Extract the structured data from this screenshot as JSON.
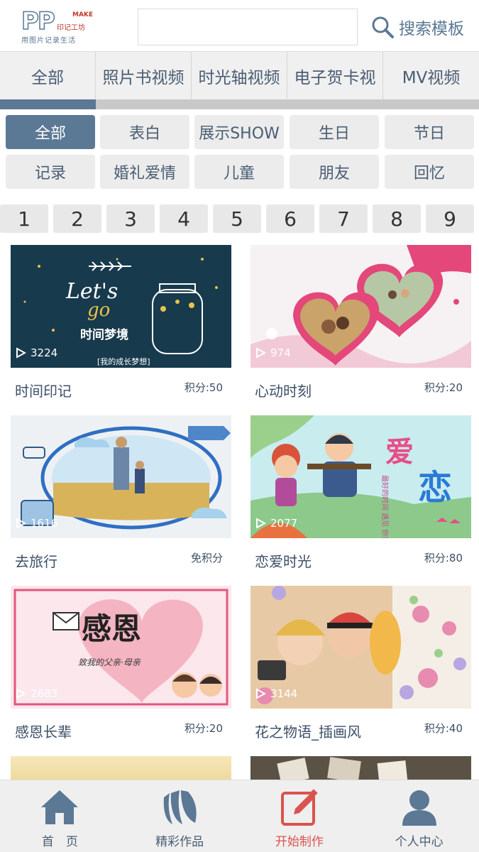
{
  "header": {
    "logo_text": "PP",
    "logo_make": "MAKE",
    "logo_brand": "印记工坊",
    "logo_slogan": "用图片记录生活",
    "search_value": "",
    "search_label": "搜索模板"
  },
  "category_tabs": [
    {
      "label": "全部",
      "active": true
    },
    {
      "label": "照片书视频"
    },
    {
      "label": "时光轴视频"
    },
    {
      "label": "电子贺卡视"
    },
    {
      "label": "MV视频"
    }
  ],
  "tags": [
    {
      "label": "全部",
      "active": true
    },
    {
      "label": "表白"
    },
    {
      "label": "展示SHOW"
    },
    {
      "label": "生日"
    },
    {
      "label": "节日"
    },
    {
      "label": "记录"
    },
    {
      "label": "婚礼爱情"
    },
    {
      "label": "儿童"
    },
    {
      "label": "朋友"
    },
    {
      "label": "回忆"
    }
  ],
  "pages": [
    "1",
    "2",
    "3",
    "4",
    "5",
    "6",
    "7",
    "8",
    "9"
  ],
  "templates": [
    {
      "title": "时间印记",
      "points": "积分:50",
      "views": "3224",
      "thumb_text": "时间梦境",
      "thumb_sub": "[我的成长梦想]",
      "thumb_lets": "Let's go"
    },
    {
      "title": "心动时刻",
      "points": "积分:20",
      "views": "974"
    },
    {
      "title": "去旅行",
      "points": "免积分",
      "views": "1616"
    },
    {
      "title": "恋爱时光",
      "points": "积分:80",
      "views": "2077",
      "thumb_big1": "爱",
      "thumb_big2": "恋",
      "thumb_small": "最好的时间 遇见 你我"
    },
    {
      "title": "感恩长辈",
      "points": "积分:20",
      "views": "2683",
      "thumb_text": "感恩",
      "thumb_sub": "致我的父亲·母亲"
    },
    {
      "title": "花之物语_插画风",
      "points": "积分:40",
      "views": "3144"
    }
  ],
  "bottom_nav": [
    {
      "label": "首　页",
      "icon": "home-icon"
    },
    {
      "label": "精彩作品",
      "icon": "works-icon"
    },
    {
      "label": "开始制作",
      "icon": "edit-icon",
      "active": true
    },
    {
      "label": "个人中心",
      "icon": "user-icon"
    }
  ],
  "colors": {
    "primary": "#5b7894",
    "active_nav": "#d9534f",
    "tag_bg": "#ececec",
    "tab_bg": "#f0f0f0"
  }
}
